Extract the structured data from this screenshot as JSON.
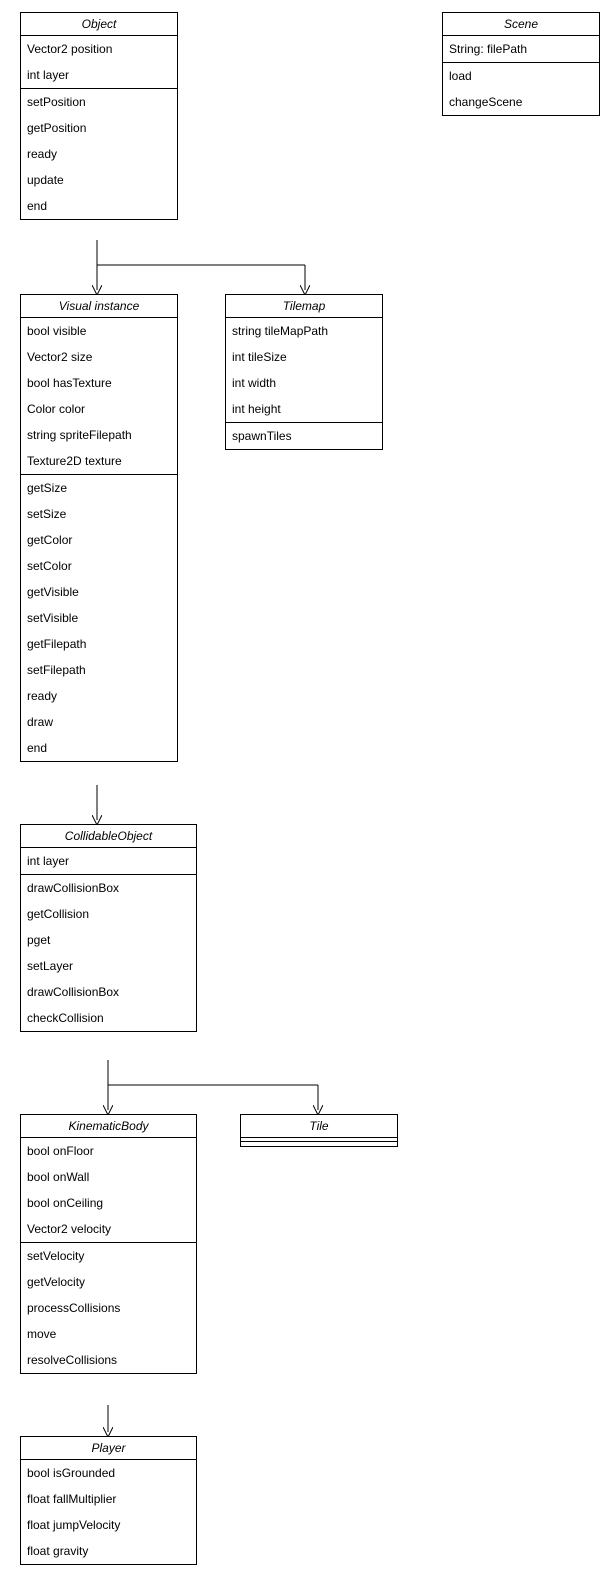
{
  "classes": {
    "object": {
      "title": "Object",
      "attrs": [
        "Vector2 position",
        "int layer"
      ],
      "methods": [
        "setPosition",
        "getPosition",
        "ready",
        "update",
        "end"
      ]
    },
    "scene": {
      "title": "Scene",
      "attrs": [
        "String: filePath"
      ],
      "methods": [
        "load",
        "changeScene"
      ]
    },
    "visual_instance": {
      "title": "Visual instance",
      "attrs": [
        "bool visible",
        "Vector2 size",
        "bool hasTexture",
        "Color color",
        "string spriteFilepath",
        "Texture2D texture"
      ],
      "methods": [
        "getSize",
        "setSize",
        "getColor",
        "setColor",
        "getVisible",
        "setVisible",
        "getFilepath",
        "setFilepath",
        "ready",
        "draw",
        "end"
      ]
    },
    "tilemap": {
      "title": "Tilemap",
      "attrs": [
        "string tileMapPath",
        "int tileSize",
        "int width",
        "int height"
      ],
      "methods": [
        "spawnTiles"
      ]
    },
    "collidable_object": {
      "title": "CollidableObject",
      "attrs": [
        "int layer"
      ],
      "methods": [
        "drawCollisionBox",
        "getCollision",
        "pget",
        "setLayer",
        "drawCollisionBox",
        "checkCollision"
      ]
    },
    "kinematic_body": {
      "title": "KinematicBody",
      "attrs": [
        "bool onFloor",
        "bool onWall",
        "bool onCeiling",
        "Vector2 velocity"
      ],
      "methods": [
        "setVelocity",
        "getVelocity",
        "processCollisions",
        "move",
        "resolveCollisions"
      ]
    },
    "tile": {
      "title": "Tile",
      "attrs": [],
      "methods": []
    },
    "player": {
      "title": "Player",
      "attrs": [
        "bool isGrounded",
        "float fallMultiplier",
        "float jumpVelocity",
        "float gravity"
      ],
      "methods": []
    }
  }
}
